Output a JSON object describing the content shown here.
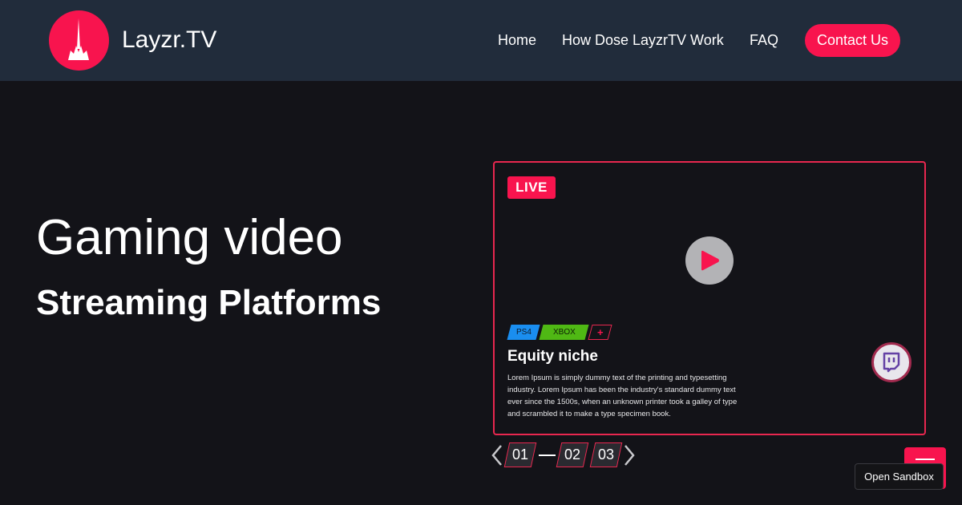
{
  "header": {
    "brand": "Layzr.TV",
    "logo_icon": "spire-icon",
    "nav": {
      "home": "Home",
      "how": "How Dose LayzrTV Work",
      "faq": "FAQ"
    },
    "contact_label": "Contact Us"
  },
  "hero": {
    "title": "Gaming video",
    "subtitle": "Streaming Platforms"
  },
  "card": {
    "live_label": "LIVE",
    "tags": {
      "ps4": "PS4",
      "xbox": "XBOX",
      "plus": "+"
    },
    "title": "Equity niche",
    "description": "Lorem Ipsum is simply dummy text of the printing and typesetting industry. Lorem Ipsum has been the industry's standard dummy text ever since the 1500s, when an unknown printer took a galley of type and scrambled it to make a type specimen book."
  },
  "pager": {
    "pages": [
      "01",
      "02",
      "03"
    ]
  },
  "sandbox_label": "Open Sandbox",
  "colors": {
    "accent": "#f8144e",
    "header_bg": "#212c3b",
    "page_bg": "#131318",
    "ps4": "#1a8ef0",
    "xbox": "#4fb814",
    "twitch": "#6441a5"
  }
}
